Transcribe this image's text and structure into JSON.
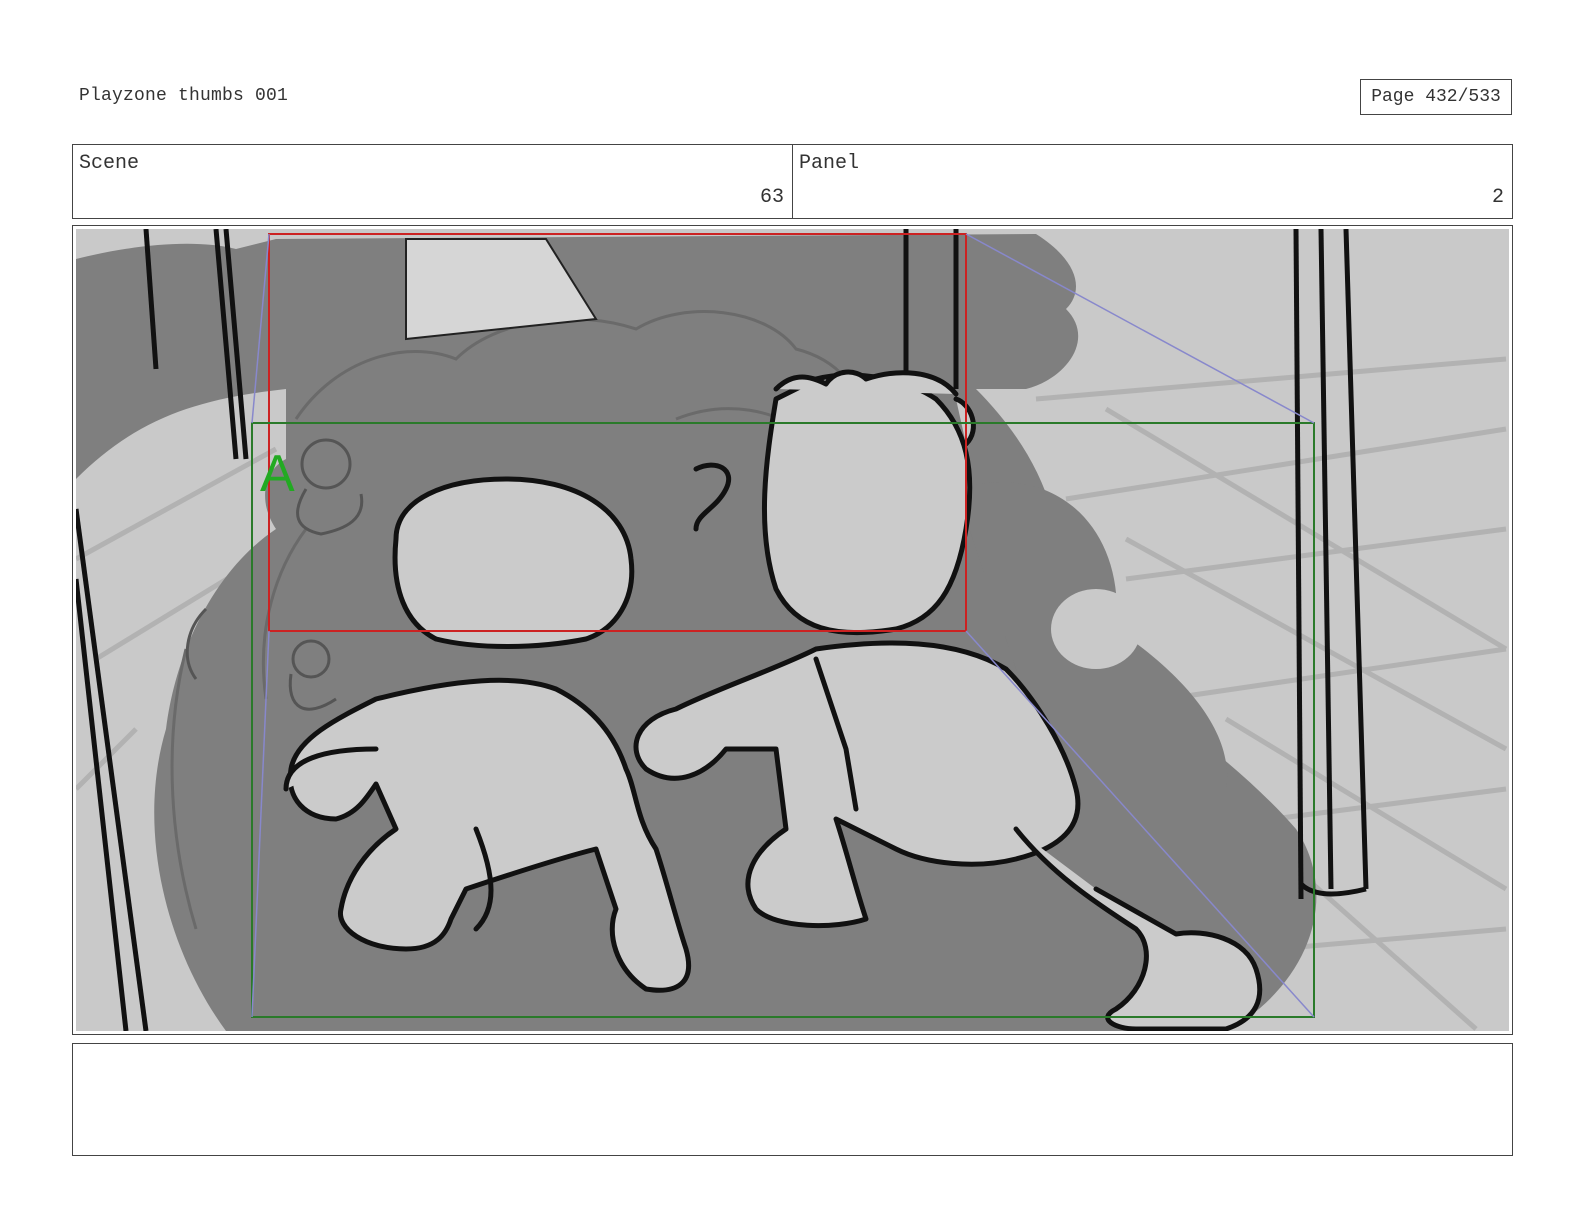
{
  "header": {
    "title": "Playzone thumbs 001",
    "page": "Page 432/533"
  },
  "info": {
    "scene_label": "Scene",
    "scene_value": "63",
    "panel_label": "Panel",
    "panel_value": "2"
  },
  "frame": {
    "camera_marker": "A",
    "guide_colors": {
      "start_frame": "#cc2222",
      "end_frame": "#2a7a2a",
      "camera_path": "#8888cc",
      "marker": "#22aa22"
    },
    "icons": [
      "storyboard-sketch",
      "kid-left",
      "kid-right",
      "slide-ball-pit",
      "support-pillar"
    ]
  },
  "notes": {
    "text": ""
  }
}
